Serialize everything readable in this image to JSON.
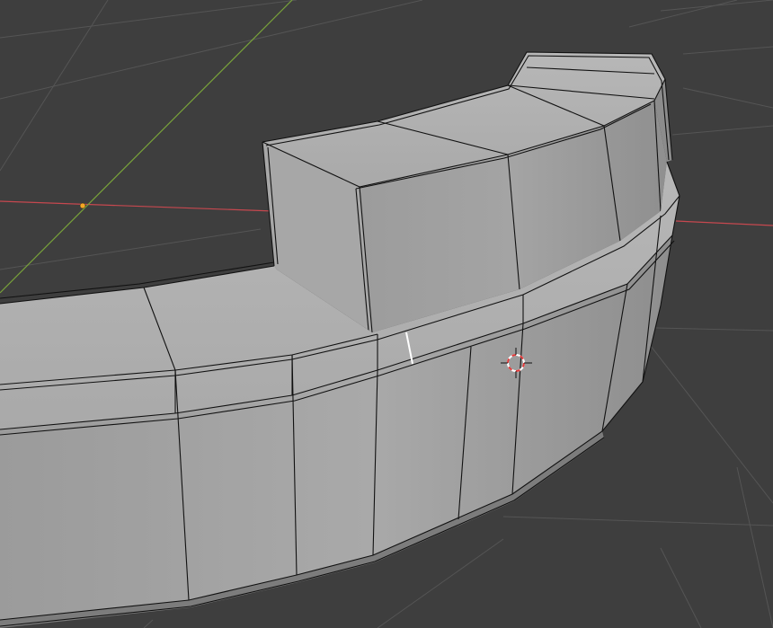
{
  "viewport": {
    "mode": "edit-mode",
    "background_color": "#3e3e3e",
    "grid_color": "#545454",
    "x_axis_color": "#c6484f",
    "y_axis_color": "#78a23a",
    "origin_color": "#f5a623",
    "mesh": {
      "face_color": "#a6a6a6",
      "face_light": "#bcbcbc",
      "face_dark": "#8a8a8a",
      "edge_color": "#111111",
      "selected_edge_color": "#ffffff"
    },
    "cursor_colors": [
      "#ffffff",
      "#e23b3b"
    ]
  }
}
